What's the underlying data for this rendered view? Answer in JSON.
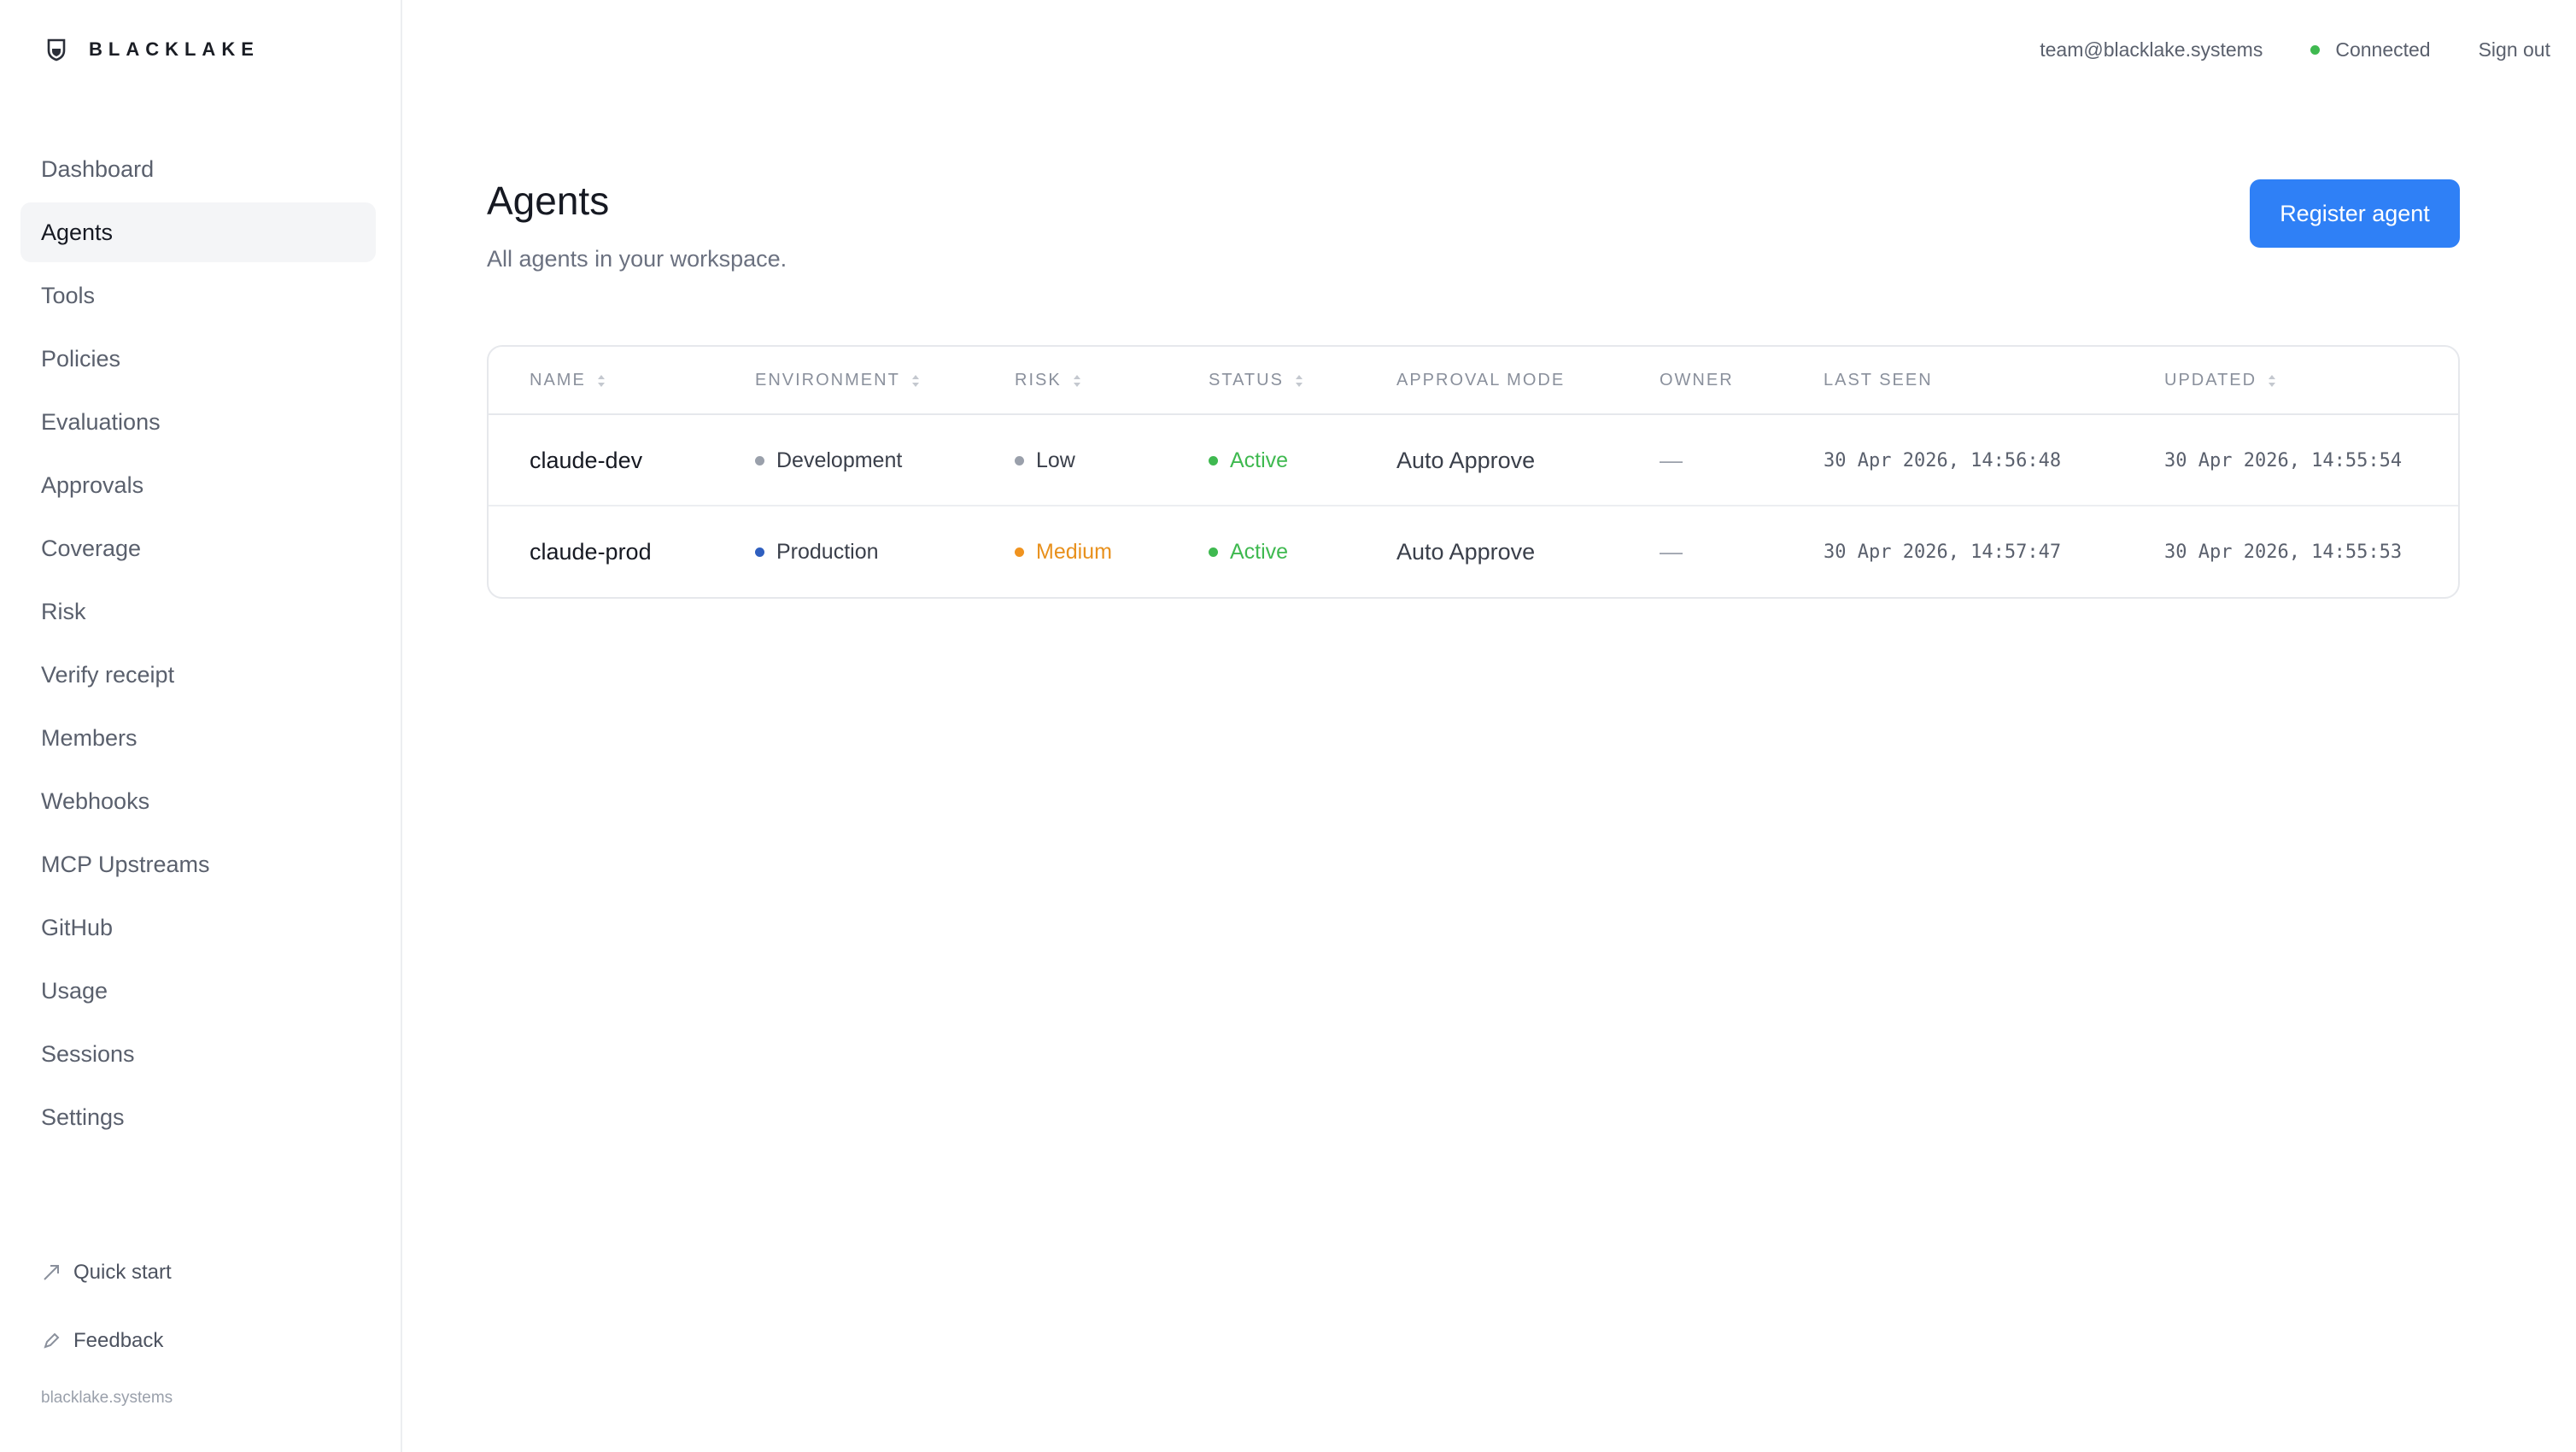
{
  "brand": {
    "name": "BLACKLAKE",
    "icon": "shield-icon"
  },
  "sidebar": {
    "items": [
      {
        "label": "Dashboard",
        "active": false
      },
      {
        "label": "Agents",
        "active": true
      },
      {
        "label": "Tools",
        "active": false
      },
      {
        "label": "Policies",
        "active": false
      },
      {
        "label": "Evaluations",
        "active": false
      },
      {
        "label": "Approvals",
        "active": false
      },
      {
        "label": "Coverage",
        "active": false
      },
      {
        "label": "Risk",
        "active": false
      },
      {
        "label": "Verify receipt",
        "active": false
      },
      {
        "label": "Members",
        "active": false
      },
      {
        "label": "Webhooks",
        "active": false
      },
      {
        "label": "MCP Upstreams",
        "active": false
      },
      {
        "label": "GitHub",
        "active": false
      },
      {
        "label": "Usage",
        "active": false
      },
      {
        "label": "Sessions",
        "active": false
      },
      {
        "label": "Settings",
        "active": false
      }
    ],
    "quick_start": {
      "label": "Quick start",
      "icon": "arrow-up-right-icon"
    },
    "feedback": {
      "label": "Feedback",
      "icon": "pencil-icon"
    },
    "footer": "blacklake.systems"
  },
  "topbar": {
    "email": "team@blacklake.systems",
    "connection": "Connected",
    "connection_color": "#3fb950",
    "signout": "Sign out"
  },
  "page": {
    "title": "Agents",
    "subtitle": "All agents in your workspace.",
    "primary_button": "Register agent",
    "accent": "#2f80f6"
  },
  "table": {
    "headers": [
      "NAME",
      "ENVIRONMENT",
      "RISK",
      "STATUS",
      "APPROVAL MODE",
      "OWNER",
      "LAST SEEN",
      "UPDATED"
    ],
    "rows": [
      {
        "name": "claude-dev",
        "environment": "Development",
        "environment_color": "#9aa0ab",
        "risk": "Low",
        "risk_color": "#9aa0ab",
        "risk_text_color": "#3a3f4a",
        "status": "Active",
        "status_color": "#3fb950",
        "approval_mode": "Auto Approve",
        "owner": "—",
        "last_seen": "30 Apr 2026, 14:56:48",
        "updated": "30 Apr 2026, 14:55:54"
      },
      {
        "name": "claude-prod",
        "environment": "Production",
        "environment_color": "#2f5fbf",
        "risk": "Medium",
        "risk_color": "#f0931f",
        "risk_text_color": "#e8901c",
        "status": "Active",
        "status_color": "#3fb950",
        "approval_mode": "Auto Approve",
        "owner": "—",
        "last_seen": "30 Apr 2026, 14:57:47",
        "updated": "30 Apr 2026, 14:55:53"
      }
    ]
  }
}
